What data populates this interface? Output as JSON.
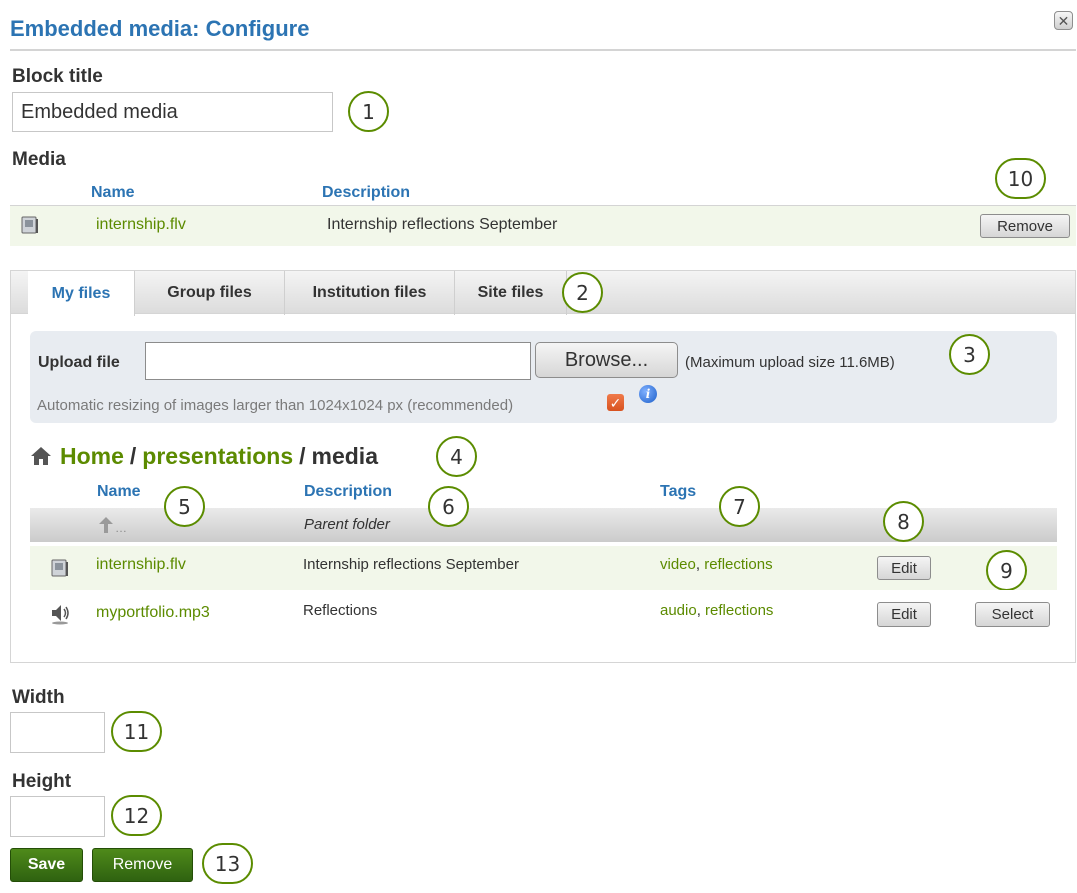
{
  "dialog": {
    "title": "Embedded media: Configure",
    "close_icon": "close-icon"
  },
  "block_title": {
    "label": "Block title",
    "value": "Embedded media"
  },
  "media": {
    "label": "Media",
    "col_name": "Name",
    "col_description": "Description",
    "row": {
      "icon": "video-file-icon",
      "name": "internship.flv",
      "description": "Internship reflections September",
      "remove_label": "Remove"
    }
  },
  "tabs": [
    {
      "label": "My files",
      "active": true
    },
    {
      "label": "Group files",
      "active": false
    },
    {
      "label": "Institution files",
      "active": false
    },
    {
      "label": "Site files",
      "active": false
    }
  ],
  "upload": {
    "label": "Upload file",
    "value": "",
    "browse_label": "Browse...",
    "max_size": "(Maximum upload size 11.6MB)",
    "resize_text": "Automatic resizing of images larger than 1024x1024 px (recommended)",
    "resize_checked": true
  },
  "breadcrumb": {
    "home": "Home",
    "sep1": "/",
    "folder": "presentations",
    "sep2": "/",
    "current": "media"
  },
  "files": {
    "col_name": "Name",
    "col_description": "Description",
    "col_tags": "Tags",
    "parent_label": "Parent folder",
    "parent_glyph": "…",
    "rows": [
      {
        "icon": "video-file-icon",
        "name": "internship.flv",
        "description": "Internship reflections September",
        "tag1": "video",
        "tag_sep": ", ",
        "tag2": "reflections",
        "edit_label": "Edit",
        "select_label": ""
      },
      {
        "icon": "audio-file-icon",
        "name": "myportfolio.mp3",
        "description": "Reflections",
        "tag1": "audio",
        "tag_sep": ", ",
        "tag2": "reflections",
        "edit_label": "Edit",
        "select_label": "Select"
      }
    ]
  },
  "width": {
    "label": "Width",
    "value": ""
  },
  "height": {
    "label": "Height",
    "value": ""
  },
  "actions": {
    "save_label": "Save",
    "remove_label": "Remove"
  },
  "callouts": [
    "1",
    "2",
    "3",
    "4",
    "5",
    "6",
    "7",
    "8",
    "9",
    "10",
    "11",
    "12",
    "13"
  ],
  "colors": {
    "accent": "#2c74b3",
    "link": "#5c8b00",
    "callout_ring": "#5b8c00",
    "save": "#3a7214"
  }
}
